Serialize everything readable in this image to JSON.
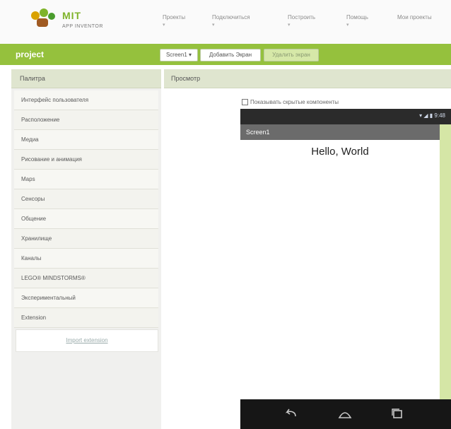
{
  "header": {
    "logo_mit": "MIT",
    "logo_sub": "APP INVENTOR",
    "nav": [
      {
        "label": "Проекты"
      },
      {
        "label": "Подключиться"
      },
      {
        "label": "Построить"
      },
      {
        "label": "Помощь"
      },
      {
        "label": "Мои проекты"
      }
    ]
  },
  "project_bar": {
    "project_name": "project",
    "screen_select": "Screen1 ▾",
    "add_screen": "Добавить Экран",
    "remove_screen": "Удалить экран"
  },
  "palette": {
    "title": "Палитра",
    "items": [
      {
        "label": "Интерфейс пользователя"
      },
      {
        "label": "Расположение"
      },
      {
        "label": "Медиа"
      },
      {
        "label": "Рисование и анимация"
      },
      {
        "label": "Maps"
      },
      {
        "label": "Сенсоры"
      },
      {
        "label": "Общение"
      },
      {
        "label": "Хранилище"
      },
      {
        "label": "Каналы"
      },
      {
        "label": "LEGO® MINDSTORMS®"
      },
      {
        "label": "Экспериментальный"
      },
      {
        "label": "Extension"
      }
    ],
    "extension_link": "Import extension"
  },
  "viewer": {
    "title": "Просмотр",
    "show_hidden_label": "Показывать скрытые компоненты",
    "status_time": "9:48",
    "screen_title": "Screen1",
    "hello_text": "Hello, World"
  },
  "colors": {
    "accent_green": "#95c13d",
    "panel_header": "#dfe5cf",
    "phone_status": "#2b2b2b",
    "phone_nav": "#161616"
  }
}
